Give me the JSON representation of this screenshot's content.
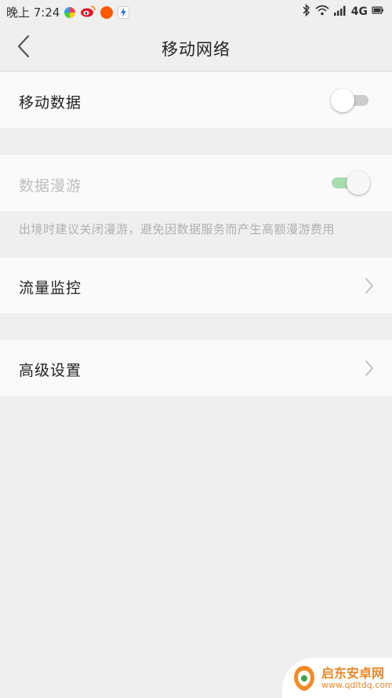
{
  "status_bar": {
    "time": "晚上 7:24",
    "network": "4G",
    "icons": [
      "app-icon-1",
      "weibo-icon",
      "app-icon-3",
      "app-icon-4",
      "bluetooth-icon",
      "wifi-icon",
      "signal-icon"
    ]
  },
  "header": {
    "title": "移动网络",
    "back_icon": "chevron-left-icon"
  },
  "settings": {
    "mobile_data": {
      "label": "移动数据",
      "enabled": false
    },
    "roaming": {
      "label": "数据漫游",
      "enabled": true,
      "disabled": true,
      "hint": "出境时建议关闭漫游，避免因数据服务而产生高额漫游费用"
    },
    "traffic_monitor": {
      "label": "流量监控"
    },
    "advanced": {
      "label": "高级设置"
    }
  },
  "colors": {
    "toggle_off_track": "#cccccc",
    "toggle_on_track": "#a8ddb0",
    "background": "#efefef",
    "row_bg": "#fafafa"
  },
  "watermark": {
    "name": "启东安卓网",
    "url": "www.qdltdq.com"
  }
}
